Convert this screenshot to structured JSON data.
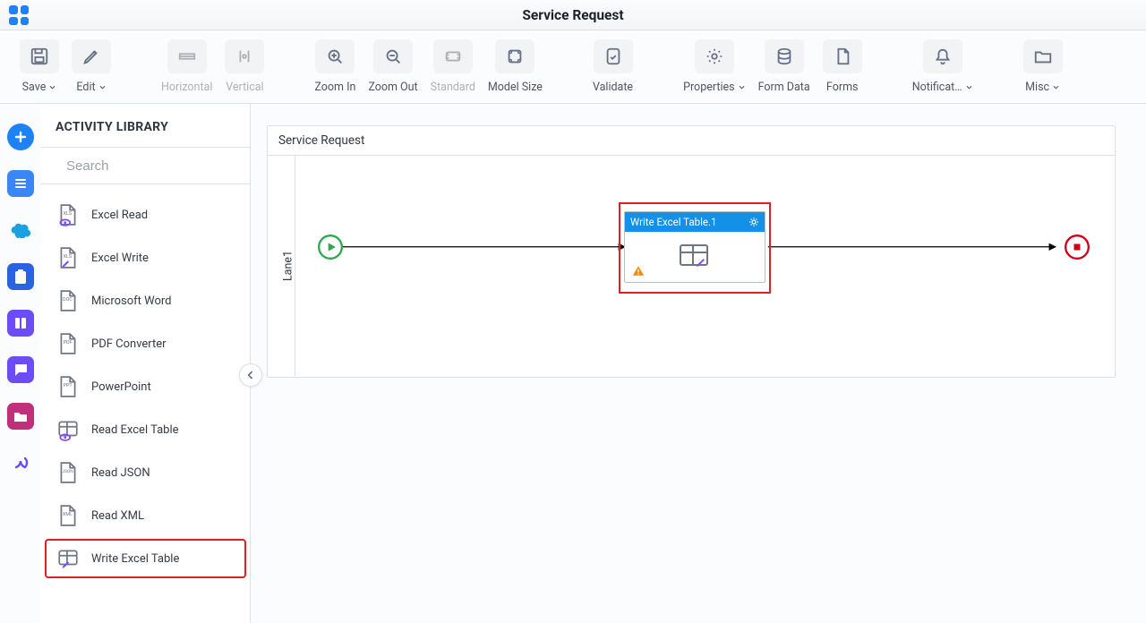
{
  "header": {
    "title": "Service Request"
  },
  "toolbar": {
    "save": {
      "label": "Save",
      "hasCaret": true,
      "disabled": false
    },
    "edit": {
      "label": "Edit",
      "hasCaret": true,
      "disabled": false
    },
    "horizontal": {
      "label": "Horizontal",
      "disabled": true
    },
    "vertical": {
      "label": "Vertical",
      "disabled": true
    },
    "zoomin": {
      "label": "Zoom In"
    },
    "zoomout": {
      "label": "Zoom Out"
    },
    "standard": {
      "label": "Standard",
      "disabled": true
    },
    "modelsize": {
      "label": "Model Size"
    },
    "validate": {
      "label": "Validate"
    },
    "properties": {
      "label": "Properties",
      "hasCaret": true
    },
    "formdata": {
      "label": "Form Data"
    },
    "forms": {
      "label": "Forms"
    },
    "notifications": {
      "label": "Notificat…",
      "hasCaret": true
    },
    "misc": {
      "label": "Misc",
      "hasCaret": true
    }
  },
  "rail": [
    {
      "id": "add",
      "title": "Add"
    },
    {
      "id": "list",
      "title": "List"
    },
    {
      "id": "salesforce",
      "title": "Salesforce"
    },
    {
      "id": "clipboard",
      "title": "Clipboard"
    },
    {
      "id": "columns",
      "title": "Columns"
    },
    {
      "id": "chat",
      "title": "Chat"
    },
    {
      "id": "folder",
      "title": "Folder"
    },
    {
      "id": "alpha",
      "title": "Alpha"
    }
  ],
  "panel": {
    "title": "ACTIVITY LIBRARY",
    "searchPlaceholder": "Search",
    "items": [
      {
        "id": "excel-read",
        "label": "Excel Read"
      },
      {
        "id": "excel-write",
        "label": "Excel Write"
      },
      {
        "id": "ms-word",
        "label": "Microsoft Word"
      },
      {
        "id": "pdf-converter",
        "label": "PDF Converter"
      },
      {
        "id": "powerpoint",
        "label": "PowerPoint"
      },
      {
        "id": "read-excel-table",
        "label": "Read Excel Table"
      },
      {
        "id": "read-json",
        "label": "Read JSON"
      },
      {
        "id": "read-xml",
        "label": "Read XML"
      },
      {
        "id": "write-excel-table",
        "label": "Write Excel Table",
        "highlight": true
      }
    ]
  },
  "canvas": {
    "title": "Service Request",
    "lane": "Lane1",
    "node": {
      "title": "Write Excel Table.1",
      "warning": true
    }
  }
}
